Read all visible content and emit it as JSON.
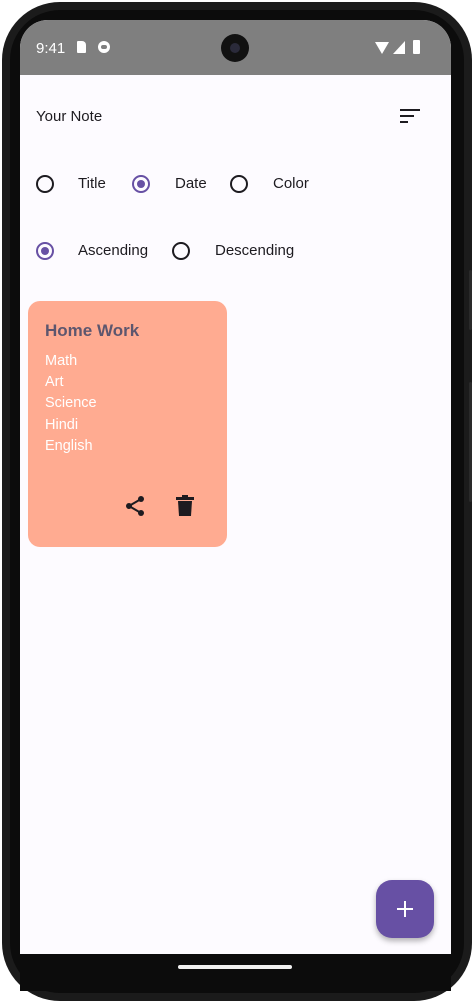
{
  "status_bar": {
    "time": "9:41",
    "icons": [
      "sim-card-icon",
      "cat-notification-icon",
      "wifi-icon",
      "signal-icon",
      "battery-icon"
    ]
  },
  "header": {
    "title": "Your Note",
    "sort_icon": "sort-icon"
  },
  "sort_by": {
    "options": [
      {
        "label": "Title",
        "selected": false
      },
      {
        "label": "Date",
        "selected": true
      },
      {
        "label": "Color",
        "selected": false
      }
    ]
  },
  "order": {
    "options": [
      {
        "label": "Ascending",
        "selected": true
      },
      {
        "label": "Descending",
        "selected": false
      }
    ]
  },
  "notes": [
    {
      "title": "Home Work",
      "lines": [
        "Math",
        "Art",
        "Science",
        "Hindi",
        "English"
      ],
      "actions": [
        "share-icon",
        "delete-icon"
      ],
      "color": "#ffab91"
    }
  ],
  "fab": {
    "icon": "add-icon"
  },
  "colors": {
    "accent": "#6750a4",
    "note_title": "#5d566e",
    "status_bar": "#7f7f7f"
  }
}
